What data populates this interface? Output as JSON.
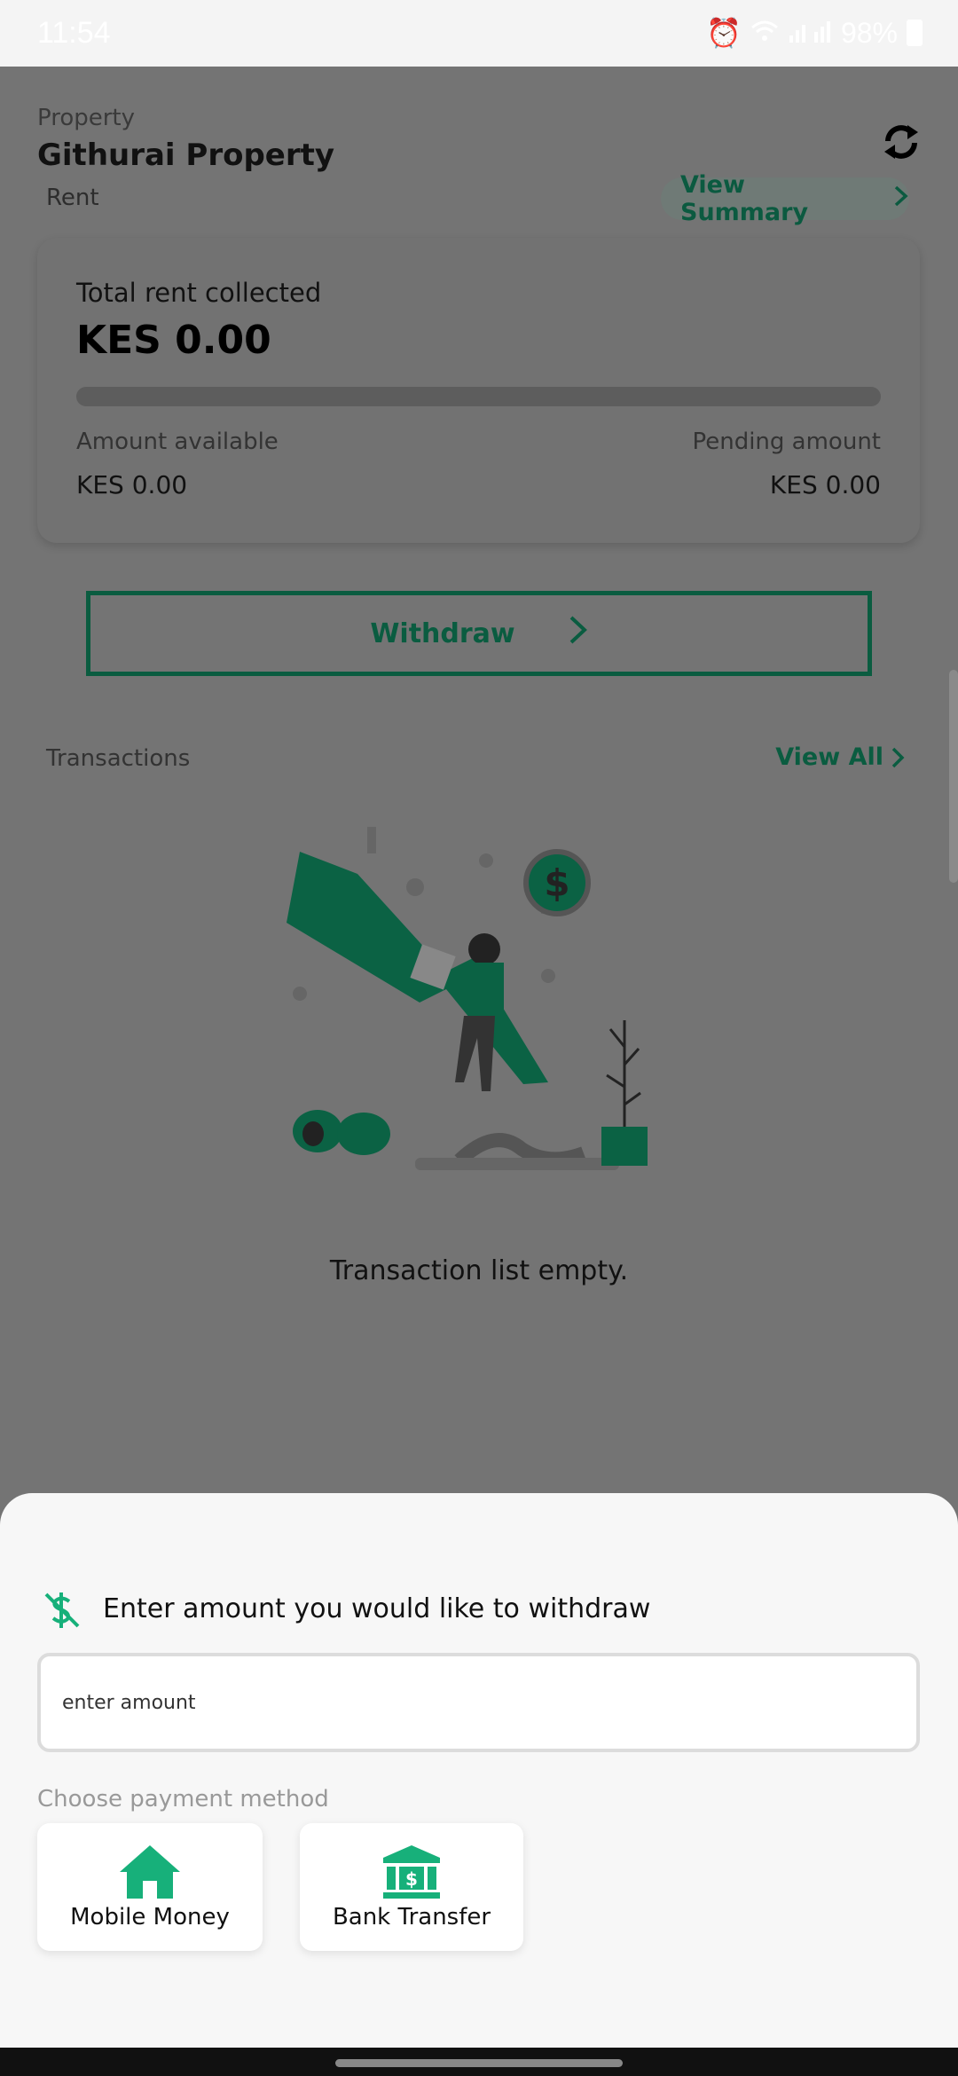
{
  "status_bar": {
    "time": "11:54",
    "battery": "98%"
  },
  "header": {
    "property_label": "Property",
    "property_name": "Githurai Property",
    "rent_label": "Rent",
    "view_summary_label": "View Summary",
    "refresh_icon": "refresh-icon"
  },
  "summary_card": {
    "title": "Total rent collected",
    "total": "KES 0.00",
    "progress_fraction": 0.0,
    "available_label": "Amount available",
    "available_value": "KES 0.00",
    "pending_label": "Pending amount",
    "pending_value": "KES 0.00"
  },
  "withdraw": {
    "label": "Withdraw"
  },
  "transactions": {
    "label": "Transactions",
    "view_all_label": "View All",
    "empty_text": "Transaction list empty."
  },
  "sheet": {
    "title": "Enter amount you would like to withdraw",
    "amount_placeholder": "enter amount",
    "payment_label": "Choose payment method",
    "options": [
      {
        "label": "Mobile Money",
        "icon": "house-icon"
      },
      {
        "label": "Bank Transfer",
        "icon": "bank-icon"
      }
    ]
  },
  "colors": {
    "accent": "#17b07a",
    "accent_dimmed": "#0a5c40",
    "overlay": "#747474",
    "sheet_bg": "#f7f7f7"
  }
}
